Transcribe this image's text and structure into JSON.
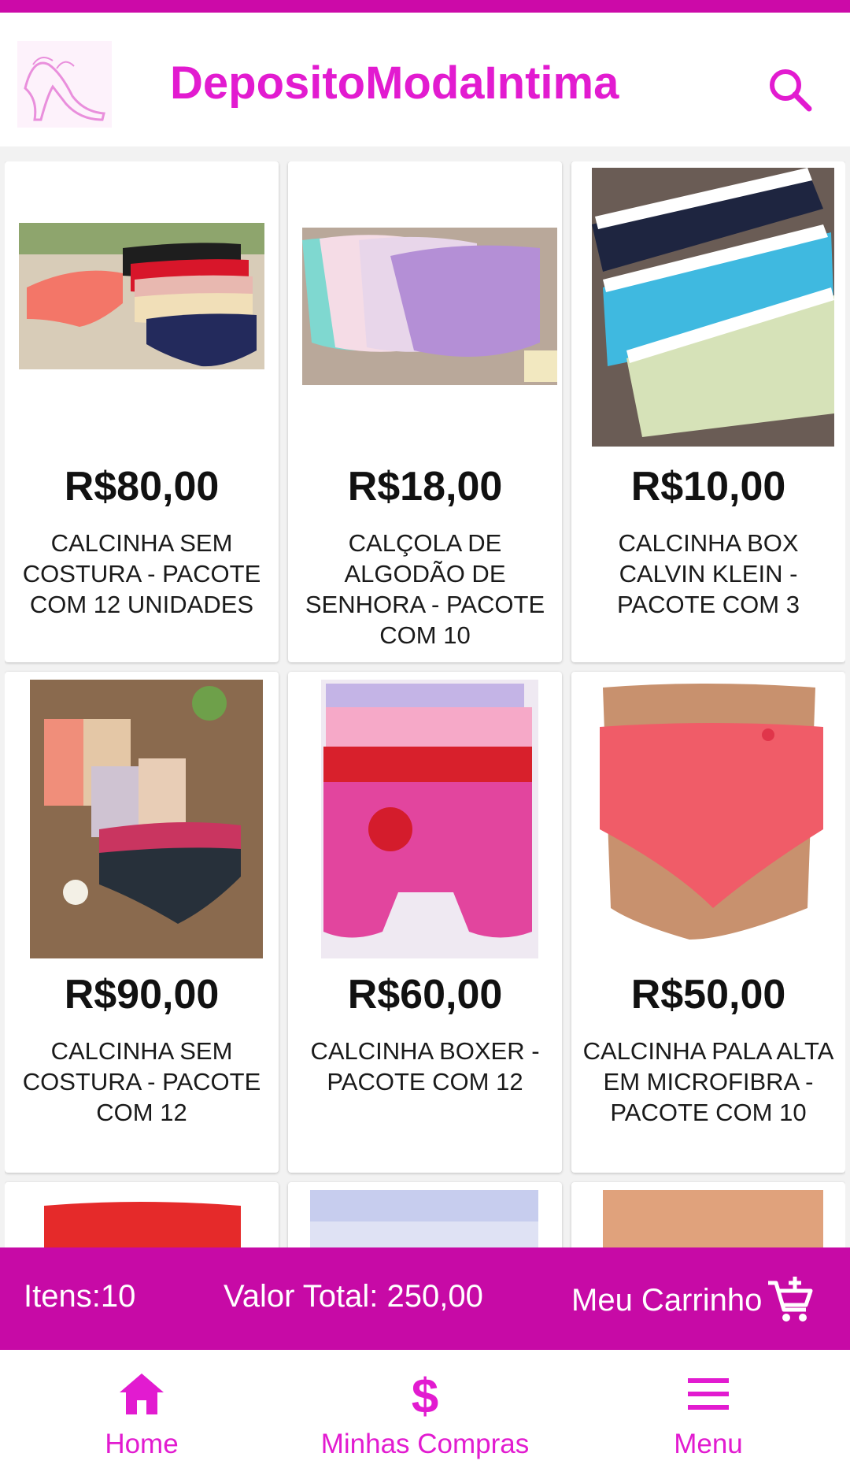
{
  "header": {
    "title": "DepositoModaIntima",
    "logo_icon": "high-heel-logo-icon",
    "search_icon": "search-icon"
  },
  "colors": {
    "brand": "#c70aa6",
    "accent": "#e21bd0"
  },
  "products": [
    {
      "price": "R$80,00",
      "name": "CALCINHA SEM COSTURA - PACOTE COM 12 UNIDADES"
    },
    {
      "price": "R$18,00",
      "name": "CALÇOLA DE ALGODÃO DE SENHORA - PACOTE COM 10"
    },
    {
      "price": "R$10,00",
      "name": "CALCINHA BOX CALVIN KLEIN - PACOTE COM 3"
    },
    {
      "price": "R$90,00",
      "name": "CALCINHA SEM COSTURA - PACOTE COM 12"
    },
    {
      "price": "R$60,00",
      "name": "CALCINHA BOXER - PACOTE COM 12"
    },
    {
      "price": "R$50,00",
      "name": "CALCINHA PALA ALTA EM MICROFIBRA - PACOTE COM 10"
    }
  ],
  "cart": {
    "items_label": "Itens:10",
    "total_label": "Valor Total: 250,00",
    "cart_label": "Meu Carrinho",
    "cart_icon": "cart-add-icon"
  },
  "nav": {
    "home": "Home",
    "purchases": "Minhas Compras",
    "menu": "Menu"
  }
}
